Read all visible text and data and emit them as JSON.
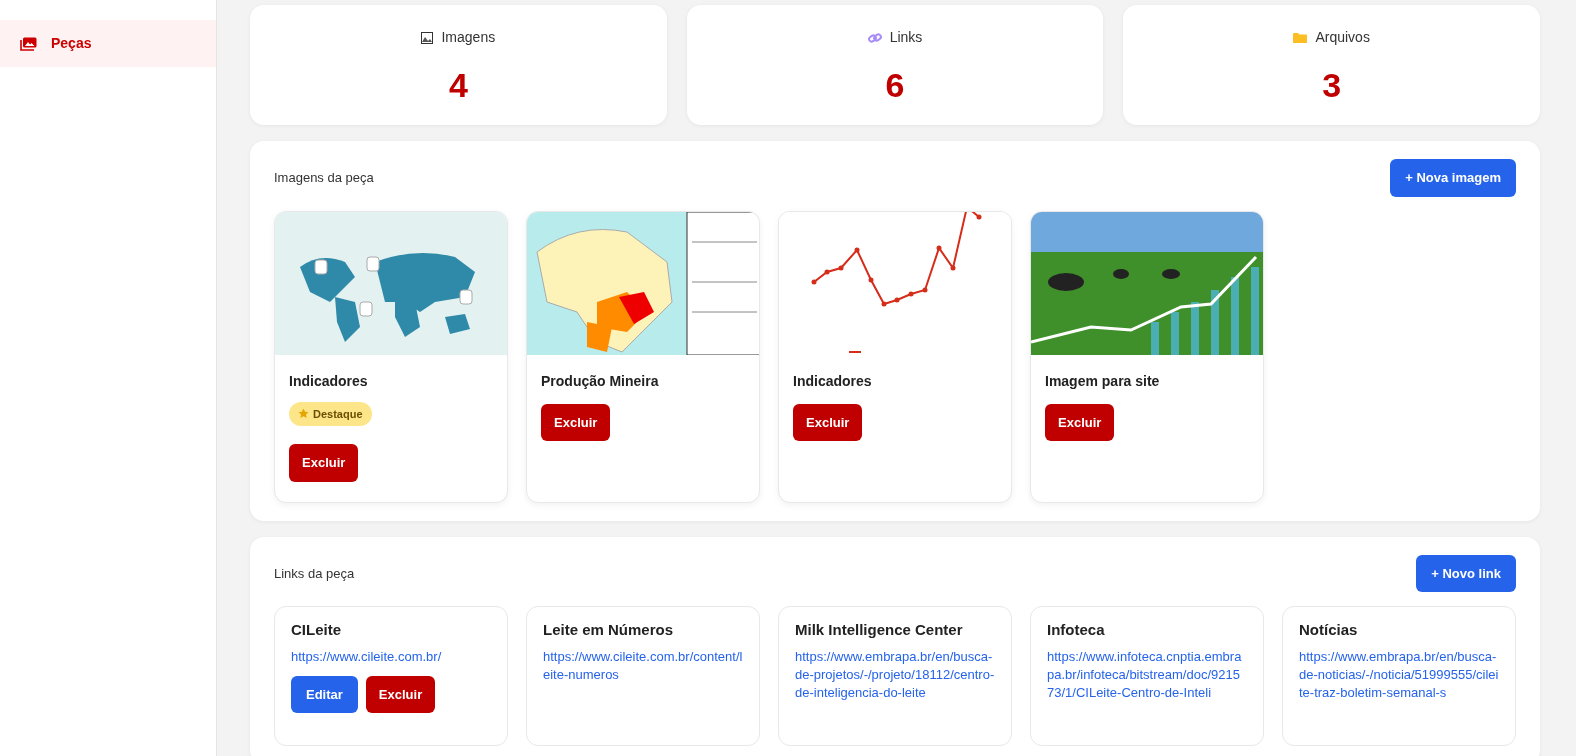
{
  "sidebar": {
    "items": [
      {
        "label": "Peças",
        "selected": true
      }
    ]
  },
  "stats": [
    {
      "kind": "image",
      "label": "Imagens",
      "value": "4"
    },
    {
      "kind": "link",
      "label": "Links",
      "value": "6"
    },
    {
      "kind": "folder",
      "label": "Arquivos",
      "value": "3"
    }
  ],
  "images_section": {
    "title": "Imagens da peça",
    "add_button": "+ Nova imagem",
    "images": [
      {
        "kind": "world-map",
        "title": "Indicadores",
        "badge": "Destaque",
        "delete_button": "Excluir"
      },
      {
        "kind": "state-map",
        "title": "Produção Mineira",
        "delete_button": "Excluir"
      },
      {
        "kind": "line-chart",
        "title": "Indicadores",
        "delete_button": "Excluir"
      },
      {
        "kind": "photo",
        "title": "Imagem para site",
        "delete_button": "Excluir"
      }
    ]
  },
  "links_section": {
    "title": "Links da peça",
    "add_button": "+ Novo link",
    "links": [
      {
        "title": "CILeite",
        "url": "https://www.cileite.com.br/",
        "buttons": [
          "Editar",
          "Excluir"
        ]
      },
      {
        "title": "Leite em Números",
        "url": "https://www.cileite.com.br/content/leite-numeros"
      },
      {
        "title": "Milk Intelligence Center",
        "url": "https://www.embrapa.br/en/busca-de-projetos/-/projeto/18112/centro-de-inteligencia-do-leite"
      },
      {
        "title": "Infoteca",
        "url": "https://www.infoteca.cnptia.embrapa.br/infoteca/bitstream/doc/921573/1/CILeite-Centro-de-Inteli"
      },
      {
        "title": "Notícias",
        "url": "https://www.embrapa.br/en/busca-de-noticias/-/noticia/51999555/cileite-traz-boletim-semanal-s"
      }
    ]
  }
}
